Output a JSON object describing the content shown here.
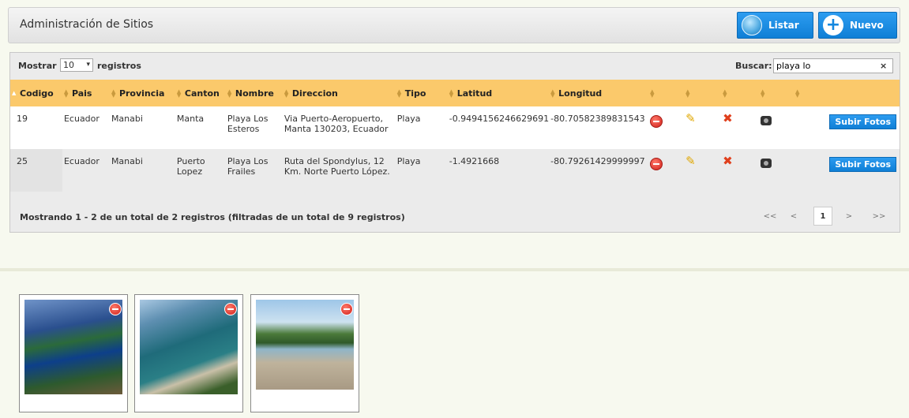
{
  "header": {
    "title": "Administración de Sitios",
    "listar_label": "Listar",
    "nuevo_label": "Nuevo"
  },
  "toolbar": {
    "show_label": "Mostrar",
    "page_size": "10",
    "records_label": "registros",
    "search_label": "Buscar:",
    "search_value": "playa lo",
    "clear_label": "×"
  },
  "table": {
    "columns": [
      "Codigo",
      "Pais",
      "Provincia",
      "Canton",
      "Nombre",
      "Direccion",
      "Tipo",
      "Latitud",
      "Longitud"
    ],
    "rows": [
      {
        "codigo": "19",
        "pais": "Ecuador",
        "provincia": "Manabi",
        "canton": "Manta",
        "nombre": "Playa Los Esteros",
        "direccion": "Via Puerto-Aeropuerto, Manta 130203, Ecuador",
        "tipo": "Playa",
        "latitud": "-0.9494156246629691",
        "longitud": "-80.70582389831543",
        "upload_label": "Subir Fotos"
      },
      {
        "codigo": "25",
        "pais": "Ecuador",
        "provincia": "Manabi",
        "canton": "Puerto Lopez",
        "nombre": "Playa Los Frailes",
        "direccion": "Ruta del Spondylus, 12 Km. Norte Puerto López.",
        "tipo": "Playa",
        "latitud": "-1.4921668",
        "longitud": "-80.79261429999997",
        "upload_label": "Subir Fotos"
      }
    ]
  },
  "footer": {
    "info": "Mostrando 1 - 2 de un total de 2 registros (filtradas de un total de 9 registros)",
    "pager": {
      "first": "<<",
      "prev": "<",
      "current": "1",
      "next": ">",
      "last": ">>"
    }
  },
  "colors": {
    "header_row": "#fbc96b",
    "button_blue": "#1387df",
    "delete_red": "#d0201a"
  }
}
